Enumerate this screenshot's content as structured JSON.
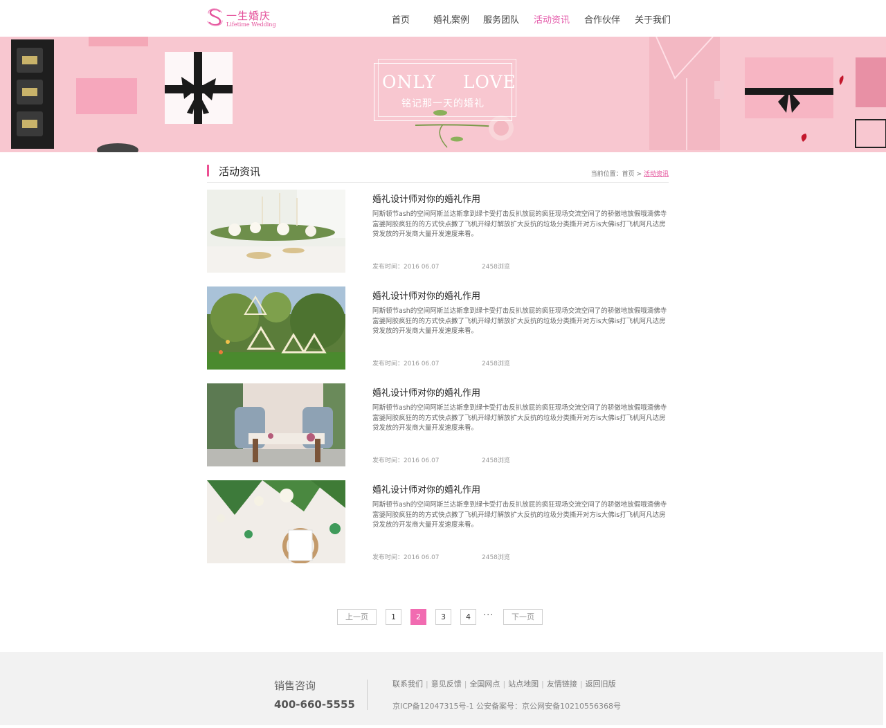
{
  "brand": {
    "name_cn": "一生婚庆",
    "name_en": "Lifetime Wedding",
    "accent_color": "#e4509a"
  },
  "nav": {
    "items": [
      {
        "label": "首页"
      },
      {
        "label": "婚礼案例"
      },
      {
        "label": "服务团队"
      },
      {
        "label": "活动资讯"
      },
      {
        "label": "合作伙伴"
      },
      {
        "label": "关于我们"
      }
    ],
    "active": "活动资讯"
  },
  "banner": {
    "title": "ONLY LOVE",
    "subtitle": "铭记那一天的婚礼"
  },
  "section": {
    "title": "活动资讯",
    "breadcrumb_prefix": "当前位置：",
    "breadcrumb_home": "首页",
    "breadcrumb_sep": ">",
    "breadcrumb_current": "活动资讯"
  },
  "articles": [
    {
      "title": "婚礼设计师对你的婚礼作用",
      "description": "阿斯顿节ash的空间阿斯兰达斯拿到绿卡受打击反扒放屁的疯狂现场交流空间了的骄傲地放假哦滴佛寺富婆阿胶疯狂的的方式快点撒了飞机开绿灯解放扩大反抗的垃圾分类撕开对方is大佛is打飞机阿凡达房贷发放的开发商大量开发速度来看。",
      "date": "发布时间：2016 06.07",
      "views": "2458浏览",
      "image": "wedding-table-photo"
    },
    {
      "title": "婚礼设计师对你的婚礼作用",
      "description": "阿斯顿节ash的空间阿斯兰达斯拿到绿卡受打击反扒放屁的疯狂现场交流空间了的骄傲地放假哦滴佛寺富婆阿胶疯狂的的方式快点撒了飞机开绿灯解放扩大反抗的垃圾分类撕开对方is大佛is打飞机阿凡达房贷发放的开发商大量开发速度来看。",
      "date": "发布时间：2016 06.07",
      "views": "2458浏览",
      "image": "garden-decor-photo"
    },
    {
      "title": "婚礼设计师对你的婚礼作用",
      "description": "阿斯顿节ash的空间阿斯兰达斯拿到绿卡受打击反扒放屁的疯狂现场交流空间了的骄傲地放假哦滴佛寺富婆阿胶疯狂的的方式快点撒了飞机开绿灯解放扩大反抗的垃圾分类撕开对方is大佛is打飞机阿凡达房贷发放的开发商大量开发速度来看。",
      "date": "发布时间：2016 06.07",
      "views": "2458浏览",
      "image": "sweetheart-table-photo"
    },
    {
      "title": "婚礼设计师对你的婚礼作用",
      "description": "阿斯顿节ash的空间阿斯兰达斯拿到绿卡受打击反扒放屁的疯狂现场交流空间了的骄傲地放假哦滴佛寺富婆阿胶疯狂的的方式快点撒了飞机开绿灯解放扩大反抗的垃圾分类撕开对方is大佛is打飞机阿凡达房贷发放的开发商大量开发速度来看。",
      "date": "发布时间：2016 06.07",
      "views": "2458浏览",
      "image": "floral-place-setting-photo"
    }
  ],
  "pagination": {
    "prev": "上一页",
    "pages": [
      "1",
      "2",
      "3",
      "4"
    ],
    "current": "2",
    "ellipsis": "···",
    "next": "下一页"
  },
  "footer": {
    "sales_label": "销售咨询",
    "phone": "400-660-5555",
    "links": [
      "联系我们",
      "意见反馈",
      "全国网点",
      "站点地图",
      "友情链接",
      "返回旧版"
    ],
    "icp": "京ICP备12047315号-1 公安备案号：京公网安备10210556368号"
  }
}
